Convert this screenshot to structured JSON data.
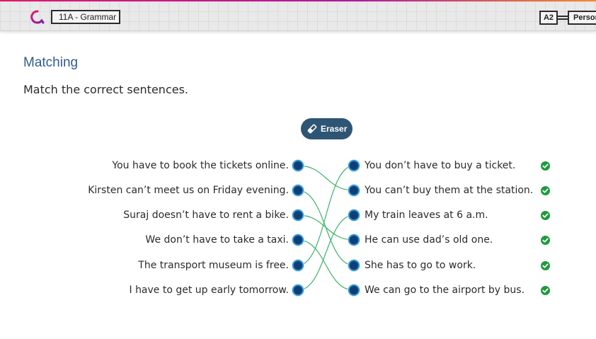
{
  "header": {
    "unit_title": "11A - Grammar",
    "level": "A2",
    "topic": "Personal"
  },
  "exercise": {
    "title": "Matching",
    "instructions": "Match the correct sentences.",
    "eraser_label": "Eraser"
  },
  "left_items": [
    "You have to book the tickets online.",
    "Kirsten can’t meet us on Friday evening.",
    "Suraj doesn’t have to rent a bike.",
    "We don’t have to take a taxi.",
    "The transport museum is free.",
    "I have to get up early tomorrow."
  ],
  "right_items": [
    "You don’t have to buy a ticket.",
    "You can’t buy them at the station.",
    "My train leaves at 6 a.m.",
    "He can use dad’s old one.",
    "She has to go to work.",
    "We can go to the airport by bus."
  ],
  "matches": [
    [
      0,
      1
    ],
    [
      1,
      4
    ],
    [
      2,
      3
    ],
    [
      3,
      5
    ],
    [
      4,
      0
    ],
    [
      5,
      2
    ]
  ],
  "colors": {
    "line": "#3db36a",
    "dot": "#0e3f73",
    "dot_ring": "#2e8fd0",
    "check": "#1f9a3c",
    "title": "#2e5d8f",
    "eraser": "#2f5574"
  }
}
